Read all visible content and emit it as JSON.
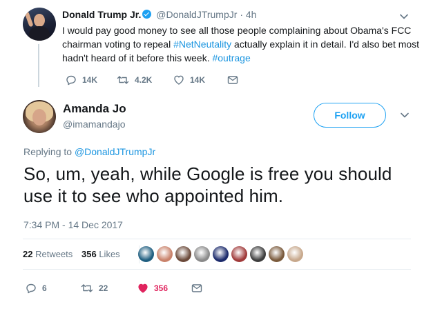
{
  "parent_tweet": {
    "name": "Donald Trump Jr.",
    "verified": true,
    "handle": "@DonaldJTrumpJr",
    "separator": "·",
    "time": "4h",
    "text_parts": [
      {
        "text": "I would pay good money to see all those people complaining about Obama's FCC chairman voting to repeal ",
        "link": false
      },
      {
        "text": "#NetNeutality",
        "link": true
      },
      {
        "text": " actually explain it in detail. I'd also bet most hadn't heard of it before this week. ",
        "link": false
      },
      {
        "text": "#outrage",
        "link": true
      }
    ],
    "actions": {
      "replies": "14K",
      "retweets": "4.2K",
      "likes": "14K"
    }
  },
  "main_tweet": {
    "name": "Amanda Jo",
    "handle": "@imamandajo",
    "follow_label": "Follow",
    "replying_label": "Replying to ",
    "replying_handle": "@DonaldJTrumpJr",
    "text": "So, um, yeah, while Google is free you should use it to see who appointed him.",
    "timestamp": "7:34 PM - 14 Dec 2017",
    "retweet_count": "22",
    "retweet_label": "Retweets",
    "like_count": "356",
    "like_label": "Likes",
    "actions": {
      "replies": "6",
      "retweets": "22",
      "likes": "356"
    }
  },
  "colors": {
    "link": "#1b95e0",
    "accent": "#1da1f2",
    "muted": "#657786",
    "like_heart": "#e0245e",
    "text": "#14171a"
  },
  "likers": [
    {
      "name": "liker-avatar-1",
      "color": "#1f5e80"
    },
    {
      "name": "liker-avatar-2",
      "color": "#c9826b"
    },
    {
      "name": "liker-avatar-3",
      "color": "#6b4a3a"
    },
    {
      "name": "liker-avatar-4",
      "color": "#8a8a8a"
    },
    {
      "name": "liker-avatar-5",
      "color": "#1b2a6b"
    },
    {
      "name": "liker-avatar-6",
      "color": "#a03a3a"
    },
    {
      "name": "liker-avatar-7",
      "color": "#3d3d3d"
    },
    {
      "name": "liker-avatar-8",
      "color": "#7a5a3c"
    },
    {
      "name": "liker-avatar-9",
      "color": "#c7a88c"
    }
  ]
}
